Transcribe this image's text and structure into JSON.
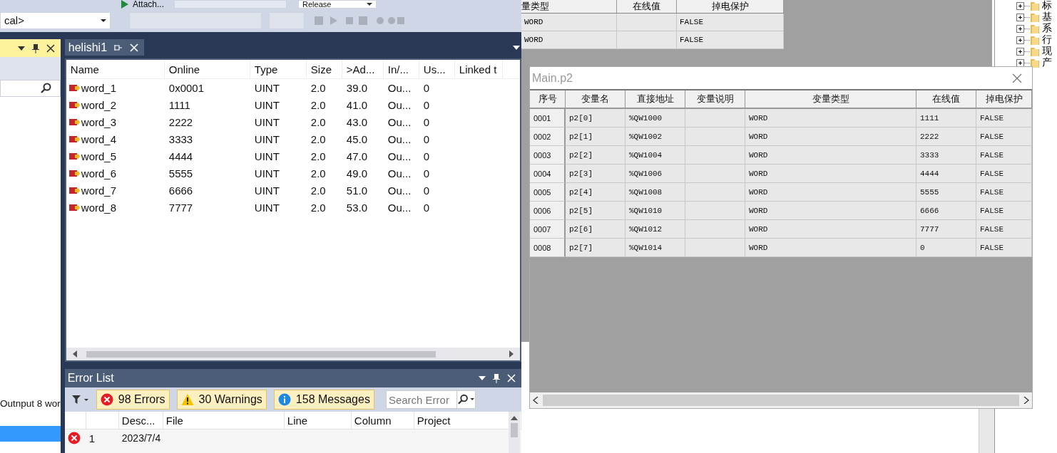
{
  "toolbar": {
    "run_label": "Attach...",
    "configuration": "Release",
    "platform": "cal>"
  },
  "left_panel": {
    "output_note": "Outnput 8 wor"
  },
  "document_tab": {
    "title": "helishi1",
    "selected": true
  },
  "variables": {
    "columns": [
      "Name",
      "Online",
      "Type",
      "Size",
      ">Ad...",
      "In/...",
      "Us...",
      "Linked t"
    ],
    "rows": [
      {
        "name": "word_1",
        "online": "0x0001",
        "type": "UINT",
        "size": "2.0",
        "address": "39.0",
        "io": "Ou...",
        "usage": "0"
      },
      {
        "name": "word_2",
        "online": "1111",
        "type": "UINT",
        "size": "2.0",
        "address": "41.0",
        "io": "Ou...",
        "usage": "0"
      },
      {
        "name": "word_3",
        "online": "2222",
        "type": "UINT",
        "size": "2.0",
        "address": "43.0",
        "io": "Ou...",
        "usage": "0"
      },
      {
        "name": "word_4",
        "online": "3333",
        "type": "UINT",
        "size": "2.0",
        "address": "45.0",
        "io": "Ou...",
        "usage": "0"
      },
      {
        "name": "word_5",
        "online": "4444",
        "type": "UINT",
        "size": "2.0",
        "address": "47.0",
        "io": "Ou...",
        "usage": "0"
      },
      {
        "name": "word_6",
        "online": "5555",
        "type": "UINT",
        "size": "2.0",
        "address": "49.0",
        "io": "Ou...",
        "usage": "0"
      },
      {
        "name": "word_7",
        "online": "6666",
        "type": "UINT",
        "size": "2.0",
        "address": "51.0",
        "io": "Ou...",
        "usage": "0"
      },
      {
        "name": "word_8",
        "online": "7777",
        "type": "UINT",
        "size": "2.0",
        "address": "53.0",
        "io": "Ou...",
        "usage": "0"
      }
    ]
  },
  "error_list": {
    "title": "Error List",
    "filters": [
      {
        "kind": "error",
        "label": "98 Errors",
        "selected": true
      },
      {
        "kind": "warning",
        "label": "30 Warnings",
        "selected": true
      },
      {
        "kind": "info",
        "label": "158 Messages",
        "selected": true
      }
    ],
    "search_placeholder": "Search Error",
    "columns": [
      "Desc...",
      "File",
      "Line",
      "Column",
      "Project"
    ],
    "rows": [
      {
        "kind": "error",
        "index": "1",
        "description": "2023/7/4"
      }
    ]
  },
  "back_table": {
    "columns": [
      "量类型",
      "在线值",
      "掉电保护"
    ],
    "rows": [
      [
        "WORD",
        "",
        "FALSE"
      ],
      [
        "WORD",
        "",
        "FALSE"
      ]
    ]
  },
  "main_window": {
    "title": "Main.p2",
    "columns": [
      "序号",
      "变量名",
      "直接地址",
      "变量说明",
      "变量类型",
      "在线值",
      "掉电保护"
    ],
    "rows": [
      [
        "0001",
        "p2[0]",
        "%QW1000",
        "",
        "WORD",
        "1111",
        "FALSE"
      ],
      [
        "0002",
        "p2[1]",
        "%QW1002",
        "",
        "WORD",
        "2222",
        "FALSE"
      ],
      [
        "0003",
        "p2[2]",
        "%QW1004",
        "",
        "WORD",
        "3333",
        "FALSE"
      ],
      [
        "0004",
        "p2[3]",
        "%QW1006",
        "",
        "WORD",
        "4444",
        "FALSE"
      ],
      [
        "0005",
        "p2[4]",
        "%QW1008",
        "",
        "WORD",
        "5555",
        "FALSE"
      ],
      [
        "0006",
        "p2[5]",
        "%QW1010",
        "",
        "WORD",
        "6666",
        "FALSE"
      ],
      [
        "0007",
        "p2[6]",
        "%QW1012",
        "",
        "WORD",
        "7777",
        "FALSE"
      ],
      [
        "0008",
        "p2[7]",
        "%QW1014",
        "",
        "WORD",
        "0",
        "FALSE"
      ]
    ]
  },
  "tree": [
    {
      "label": "标",
      "expanded": false
    },
    {
      "label": "基",
      "expanded": false
    },
    {
      "label": "系",
      "expanded": false
    },
    {
      "label": "行",
      "expanded": false
    },
    {
      "label": "现",
      "expanded": false
    },
    {
      "label": "产",
      "expanded": false
    }
  ]
}
